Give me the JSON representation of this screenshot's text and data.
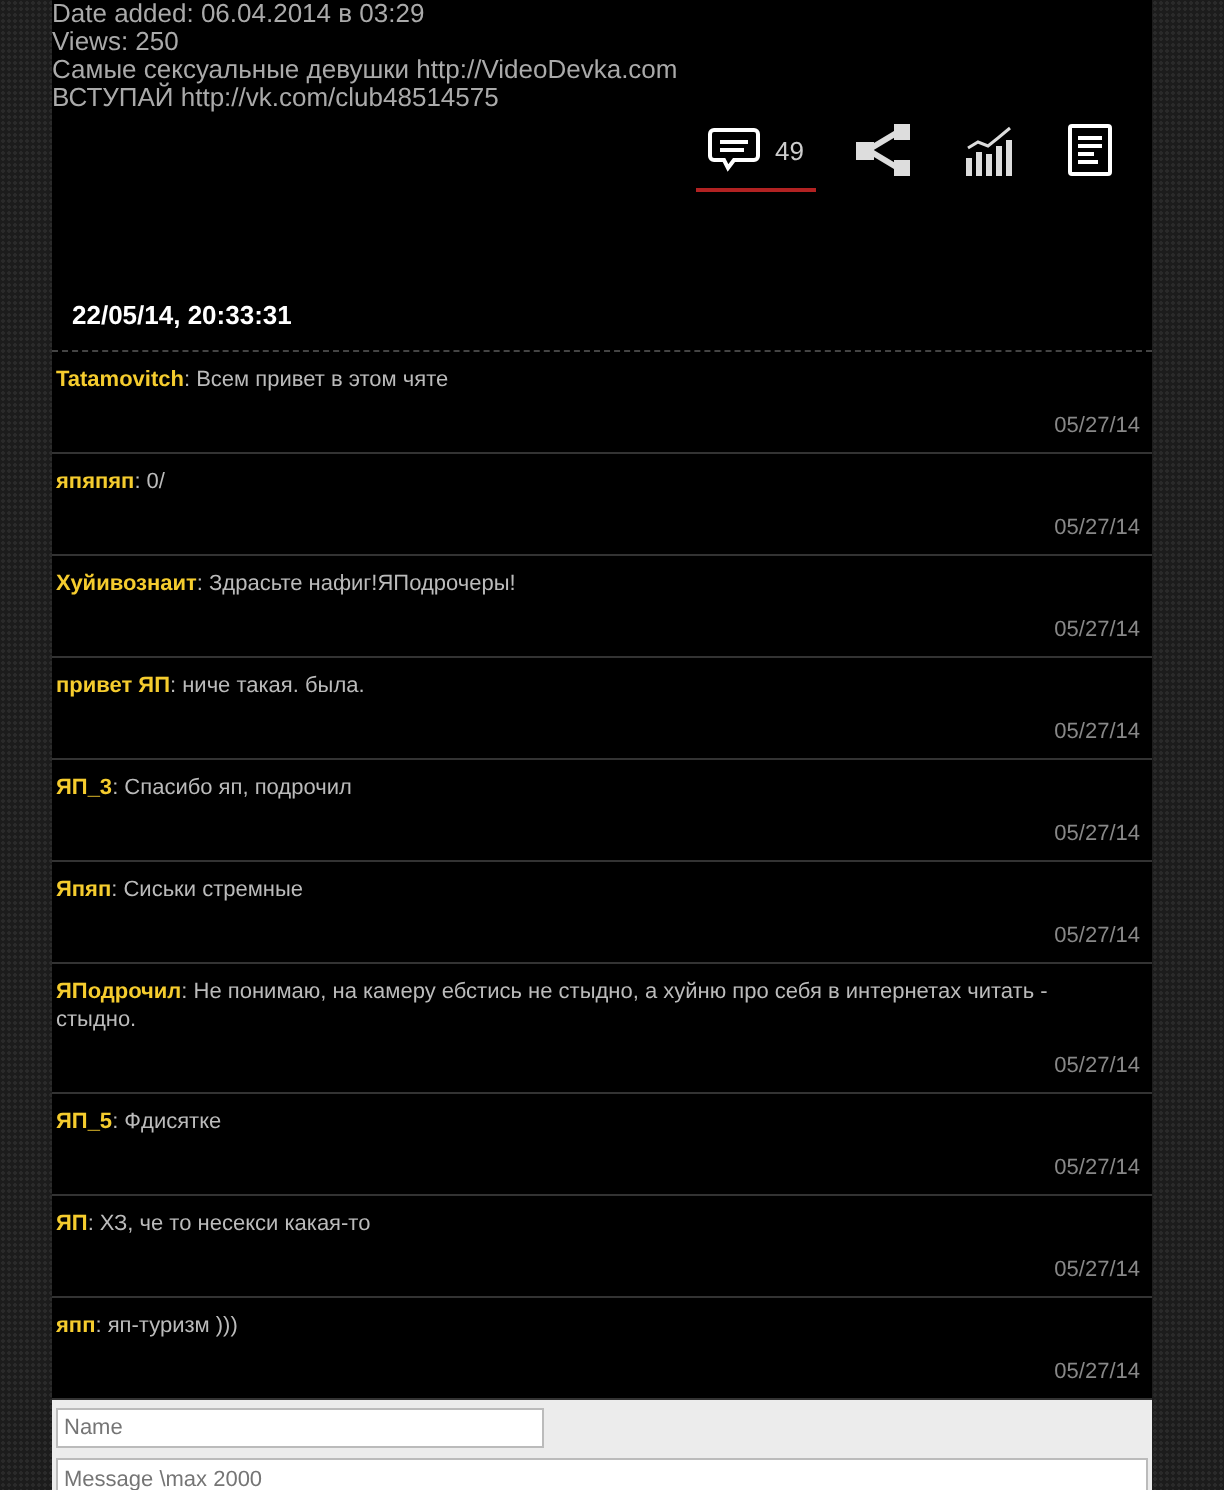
{
  "info_lines": [
    "Date added: 06.04.2014 в 03:29",
    "Views: 250",
    "Самые сексуальные девушки http://VideoDevka.com",
    "ВСТУПАЙ http://vk.com/club48514575"
  ],
  "tabs": [
    {
      "kind": "comments",
      "count": "49",
      "selected": true
    },
    {
      "kind": "share",
      "selected": false
    },
    {
      "kind": "stats",
      "selected": false
    },
    {
      "kind": "details",
      "selected": false
    }
  ],
  "chat_timestamp": "22/05/14, 20:33:31",
  "comments": [
    {
      "author": "Tatamovitch",
      "text": ": Всем привет в этом чяте",
      "date": "05/27/14"
    },
    {
      "author": "япяпяп",
      "text": ": 0/",
      "date": "05/27/14"
    },
    {
      "author": "Хуйивознаит",
      "text": ": Здрасьте нафиг!ЯПодрочеры!",
      "date": "05/27/14"
    },
    {
      "author": "привет ЯП",
      "text": ": ниче такая. была.",
      "date": "05/27/14"
    },
    {
      "author": "ЯП_3",
      "text": ": Спасибо яп, подрочил",
      "date": "05/27/14"
    },
    {
      "author": "Япяп",
      "text": ": Сиськи стремные",
      "date": "05/27/14"
    },
    {
      "author": "ЯПодрочил",
      "text": ": Не понимаю, на камеру ебстись не стыдно, а хуйню про себя в интернетах читать - стыдно.",
      "date": "05/27/14"
    },
    {
      "author": "ЯП_5",
      "text": ": Фдисятке",
      "date": "05/27/14"
    },
    {
      "author": "ЯП",
      "text": ": ХЗ, че то несекси какая-то",
      "date": "05/27/14"
    },
    {
      "author": "япп",
      "text": ": яп-туризм )))",
      "date": "05/27/14"
    }
  ],
  "form": {
    "name_placeholder": "Name",
    "message_placeholder": "Message \\max 2000"
  }
}
